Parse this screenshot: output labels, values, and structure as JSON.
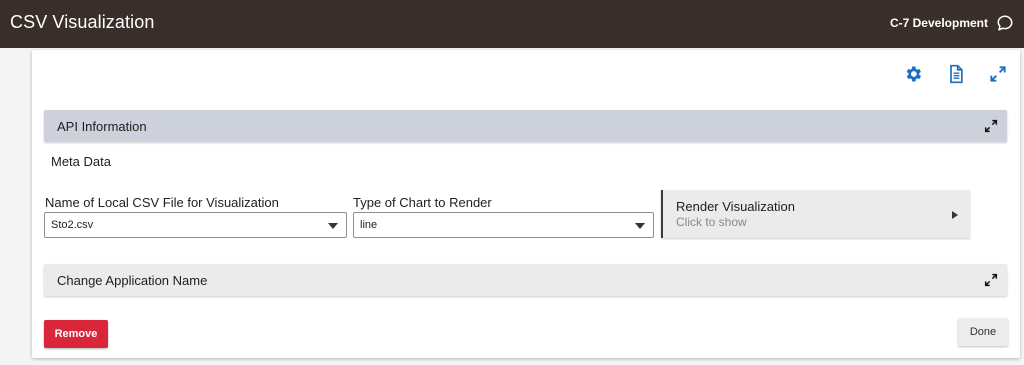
{
  "header": {
    "title": "CSV Visualization",
    "environment": "C-7 Development"
  },
  "toolbar": {
    "icons": [
      "gear-icon",
      "document-icon",
      "fullscreen-expand-icon"
    ],
    "accent_color": "#1a6fbf"
  },
  "panels": {
    "api_information": "API Information",
    "meta_data": "Meta Data",
    "change_application_name": "Change Application Name"
  },
  "form": {
    "csv_file_label": "Name of Local CSV File for Visualization",
    "csv_file_value": "Sto2.csv",
    "chart_type_label": "Type of Chart to Render",
    "chart_type_value": "line"
  },
  "render": {
    "title": "Render Visualization",
    "subtitle": "Click to show"
  },
  "buttons": {
    "remove": "Remove",
    "done": "Done"
  },
  "colors": {
    "topbar": "#3a2e2a",
    "api_panel": "#cdd1dc",
    "remove_button": "#d9263a"
  }
}
